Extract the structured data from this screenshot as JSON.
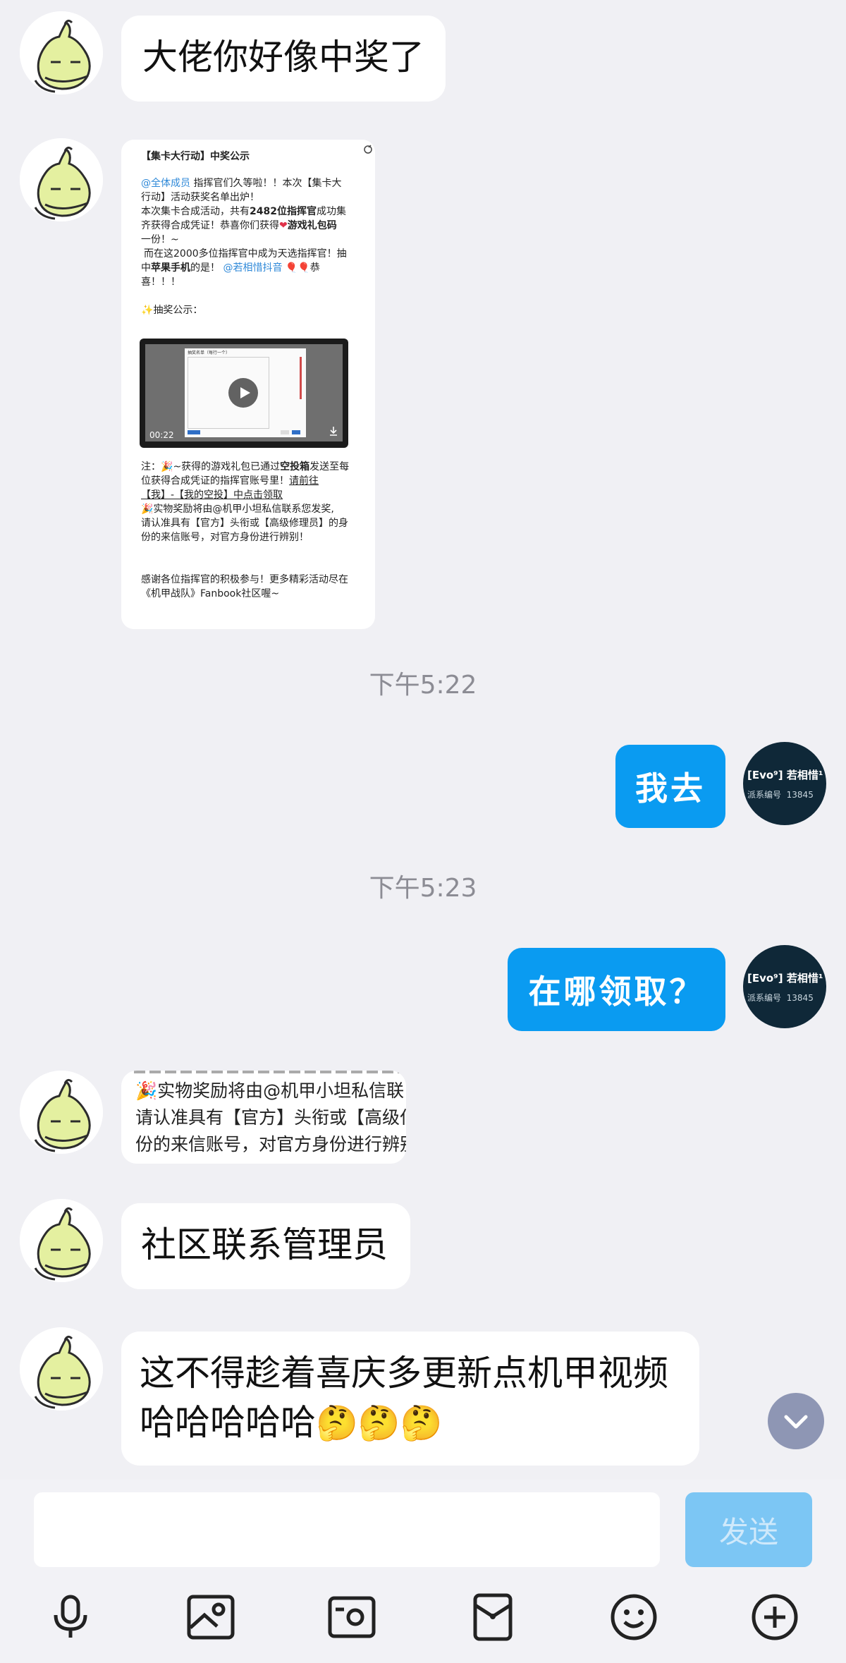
{
  "messages": {
    "m1": "大佬你好像中奖了",
    "time1": "下午5:22",
    "me1": "我去",
    "time2": "下午5:23",
    "me2": "在哪领取？",
    "m3": "社区联系管理员",
    "m4_line1": "这不得趁着喜庆多更新点机甲视频",
    "m4_line2": "哈哈哈哈哈"
  },
  "card": {
    "title": "【集卡大行动】中奖公示",
    "mention_all": "@全体成员",
    "l1_rest": "指挥官们久等啦！！本次【集卡大",
    "l2": "行动】活动获奖名单出炉！",
    "l3_a": "本次集卡合成活动，共有",
    "l3_b": "2482位指挥官",
    "l3_c": "成功集",
    "l4_a": "齐获得合成凭证！恭喜你们获得",
    "l4_b": "游戏礼包码",
    "l5": "一份！~",
    "l6": "而在这2000多位指挥官中成为天选指挥官！抽",
    "l7_a": "中",
    "l7_b": "苹果手机",
    "l7_c": "的是！",
    "l7_mention": "@若相惜抖音",
    "l7_d": "恭",
    "l8": "喜！！！",
    "l9": "抽奖公示：",
    "video_duration": "00:22",
    "video_dialog_title": "抽奖名单（每行一个）",
    "n1_a": "注：",
    "n1_b": "~获得的游戏礼包已通过",
    "n1_c": "空投箱",
    "n1_d": "发送至每",
    "n2_a": "位获得合成凭证的指挥官账号里！",
    "n2_b": "请前往",
    "n3": "【我】-【我的空投】中点击领取",
    "n4": "实物奖励将由@机甲小坦私信联系您发奖,",
    "n5": "请认准具有【官方】头衔或【高级修理员】的身",
    "n6": "份的来信账号，对官方身份进行辨别！",
    "f1": "感谢各位指挥官的积极参与！更多精彩活动尽在",
    "f2": "《机甲战队》Fanbook社区喔~"
  },
  "crop": {
    "line1": "实物奖励将由@机甲小坦私信联",
    "line2": "请认准具有【官方】头衔或【高级仆",
    "line3": "份的来信账号，对官方身份进行辨别"
  },
  "avatar_me": {
    "tag": "[Evo⁹] 若相惜¹",
    "sub": "派系编号",
    "num": "13845"
  },
  "input": {
    "placeholder": "",
    "send_label": "发送"
  },
  "icons": [
    "microphone-icon",
    "image-icon",
    "camera-icon",
    "redpacket-icon",
    "emoji-icon",
    "plus-icon",
    "chevron-down-icon"
  ],
  "colors": {
    "accent": "#0a9bf1",
    "send_disabled": "#7cc6f4",
    "background": "#f0f0f4"
  }
}
